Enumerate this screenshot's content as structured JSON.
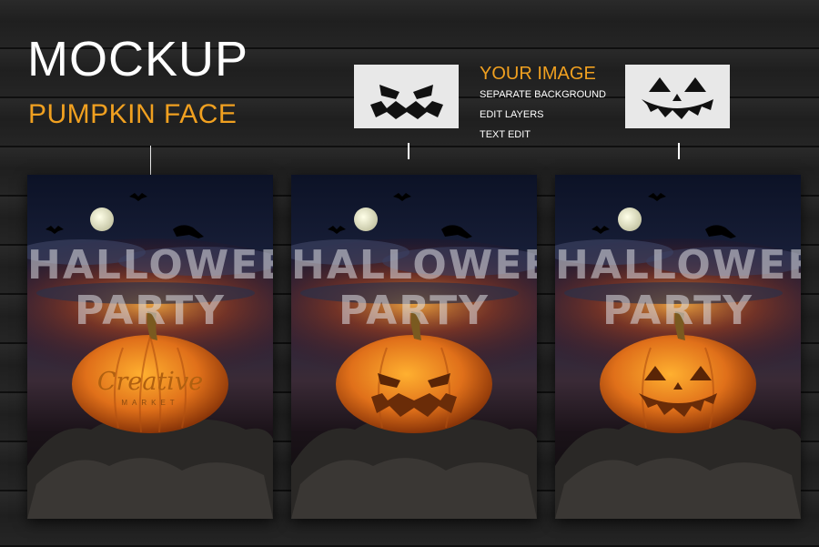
{
  "header": {
    "title": "MOCKUP",
    "subtitle": "PUMPKIN FACE"
  },
  "info": {
    "title": "YOUR IMAGE",
    "items": [
      "SEPARATE BACKGROUND",
      "EDIT LAYERS",
      "TEXT EDIT"
    ]
  },
  "colors": {
    "accent": "#f0a020",
    "text": "#ffffff",
    "wood": "#1c1c1c",
    "card": "#e8e8e8"
  },
  "face_cards": [
    {
      "icon": "angry-pumpkin-face-icon"
    },
    {
      "icon": "smiling-pumpkin-face-icon"
    }
  ],
  "posters": [
    {
      "title_line1": "HALLOWEEN",
      "title_line2": "PARTY",
      "brand": "Creative",
      "brand_sub": "MARKET",
      "face": "logo"
    },
    {
      "title_line1": "HALLOWEEN",
      "title_line2": "PARTY",
      "face": "angry"
    },
    {
      "title_line1": "HALLOWEEN",
      "title_line2": "PARTY",
      "face": "smiling"
    }
  ]
}
